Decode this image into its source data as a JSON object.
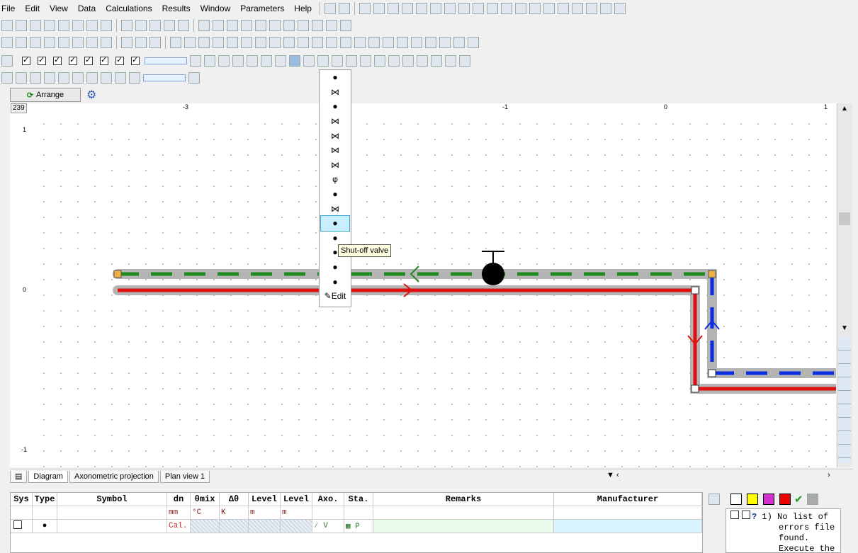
{
  "menu": [
    "File",
    "Edit",
    "View",
    "Data",
    "Calculations",
    "Results",
    "Window",
    "Parameters",
    "Help"
  ],
  "arrange": {
    "label": "Arrange"
  },
  "ruler": {
    "top_value": "239",
    "top_ticks": [
      "-3",
      "-1",
      "0",
      "1"
    ],
    "left_ticks": [
      "1",
      "0",
      "-1"
    ]
  },
  "popup": {
    "tooltip": "Shut-off valve",
    "edit_label": "Edit",
    "selected_index": 10
  },
  "tabs": [
    "Diagram",
    "Axonometric projection",
    "Plan view 1"
  ],
  "table": {
    "headers": [
      "Sys",
      "Type",
      "Symbol",
      "dn",
      "θmix",
      "Δθ",
      "Level",
      "Level",
      "Axo.",
      "Sta.",
      "Remarks",
      "Manufacturer"
    ],
    "units": [
      "",
      "",
      "",
      "mm",
      "°C",
      "K",
      "m",
      "m",
      "",
      "",
      "",
      ""
    ],
    "row": {
      "dn": "Cal.",
      "axo": "V",
      "sta": "P"
    }
  },
  "errors": {
    "lines": [
      "1) No list of",
      "errors file",
      "found.",
      "Execute the"
    ]
  },
  "colors": {
    "supply": "#e01010",
    "return": "#1f8a1f",
    "return_blue": "#0a2de0",
    "pipe_bg": "#b4b4b4",
    "highlight": "#c9efff"
  }
}
